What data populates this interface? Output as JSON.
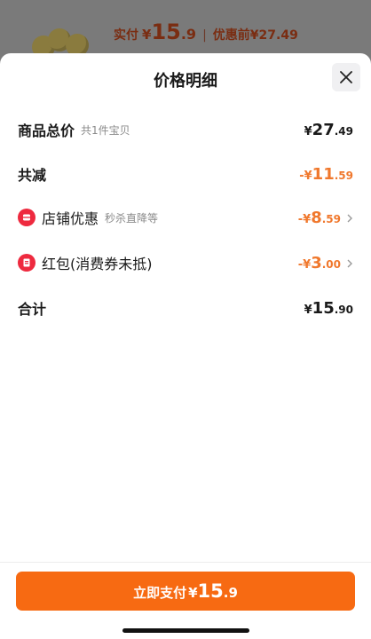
{
  "background": {
    "paid_label": "实付",
    "currency": "¥",
    "paid_int": "15",
    "paid_dec": ".9",
    "divider": "|",
    "original_label": "优惠前¥27.49"
  },
  "sheet": {
    "title": "价格明细",
    "close_icon": "close-icon",
    "rows": {
      "goods_total": {
        "label": "商品总价",
        "sub": "共1件宝贝",
        "prefix": "¥",
        "int": "27",
        "dec": ".49"
      },
      "total_discount": {
        "label": "共减",
        "prefix": "-¥",
        "int": "11",
        "dec": ".59"
      },
      "shop_discount": {
        "label": "店铺优惠",
        "sub": "秒杀直降等",
        "prefix": "-¥",
        "int": "8",
        "dec": ".59",
        "icon": "shop-coupon-icon"
      },
      "red_packet": {
        "label": "红包(消费券未抵)",
        "prefix": "-¥",
        "int": "3",
        "dec": ".00",
        "icon": "red-packet-icon"
      },
      "sum": {
        "label": "合计",
        "prefix": "¥",
        "int": "15",
        "dec": ".90"
      }
    }
  },
  "pay_button": {
    "label": "立即支付",
    "prefix": "¥",
    "int": "15",
    "dec": ".9"
  },
  "colors": {
    "accent": "#f76a12",
    "discount": "#f0782d",
    "badge": "#ee2a3f"
  }
}
